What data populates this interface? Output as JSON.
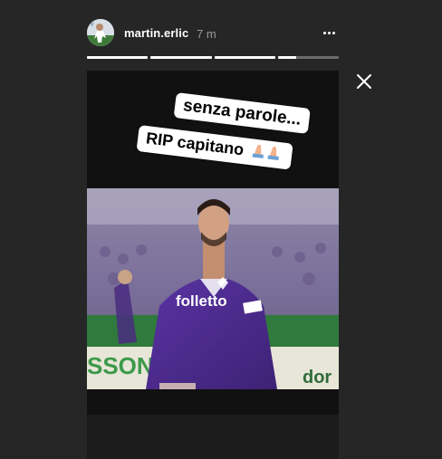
{
  "header": {
    "username": "martin.erlic",
    "time": "7 m"
  },
  "progress": {
    "segments": [
      1,
      1,
      1,
      0.3
    ]
  },
  "story": {
    "sticker_1": "senza parole...",
    "sticker_2": "RIP capitano",
    "sticker_2_emoji": "pray-hands-icon",
    "jersey_sponsor": "folletto",
    "banner_text": "SSONI",
    "banner_text_2": "dor"
  },
  "colors": {
    "background": "#262626",
    "story_background": "#111111",
    "jersey": "#4b2a8a",
    "sticker": "#ffffff"
  }
}
